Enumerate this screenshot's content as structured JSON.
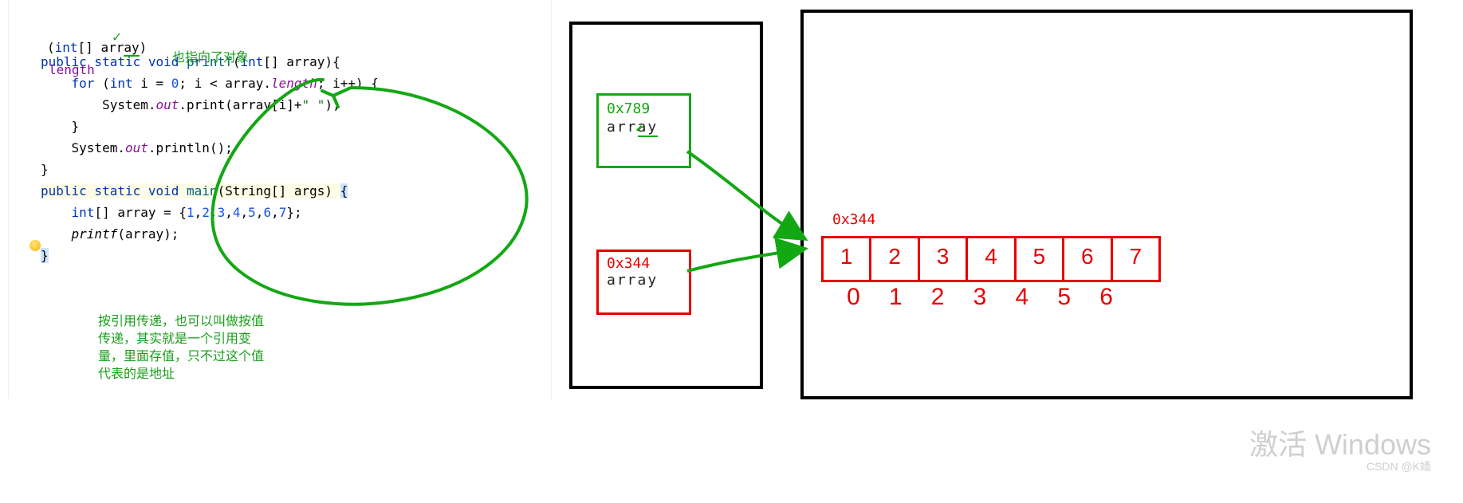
{
  "code": {
    "signature_top": "int[] array)",
    "fragment": "length",
    "annotation_top": "也指向了对象",
    "method1_sig_prefix": "public static void ",
    "method1_name": "printf",
    "method1_params": "(int[] array){",
    "for_line_prefix": "for ",
    "for_line_rest": "(int i = 0; i < array.length; i++) {",
    "print_line": "System.out.print(array[i]+\" \");",
    "close1": "}",
    "println_line": "System.out.println();",
    "close2": "}",
    "main_sig_prefix": "public static void ",
    "main_name": "main",
    "main_params": "(String[] args) ",
    "main_brace": "{",
    "array_decl": "int[] array = {1,2,3,4,5,6,7};",
    "call": "printf(array);",
    "close3": "}",
    "commentary": "按引用传递，也可以叫做按值\n传递，其实就是一个引用变\n量，里面存值，只不过这个值\n代表的是地址"
  },
  "diagram": {
    "stack": {
      "frame1": {
        "addr": "0x789",
        "var": "array"
      },
      "frame2": {
        "addr": "0x344",
        "var": "array"
      }
    },
    "heap": {
      "obj_addr": "0x344",
      "values": [
        "1",
        "2",
        "3",
        "4",
        "5",
        "6",
        "7"
      ],
      "indices": [
        "0",
        "1",
        "2",
        "3",
        "4",
        "5",
        "6"
      ]
    }
  },
  "watermarks": {
    "w1": "激活 Windows",
    "w2": "CSDN @K嫱"
  }
}
